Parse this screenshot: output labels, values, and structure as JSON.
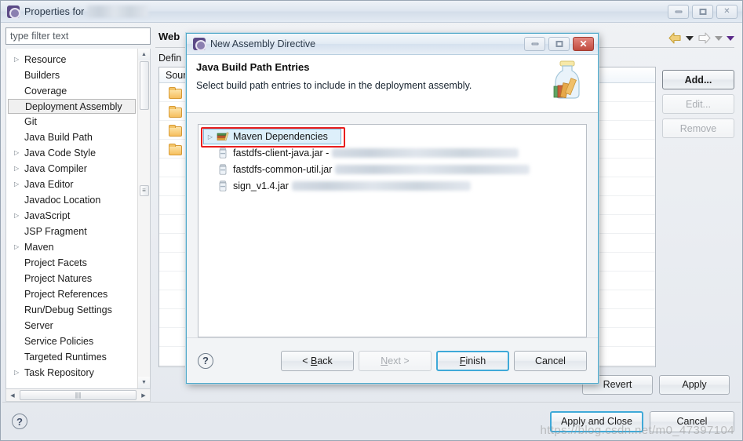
{
  "window": {
    "title": "Properties for",
    "title_redacted": true,
    "icon": "eclipse-properties-icon",
    "controls": {
      "minimize": "minimize-icon",
      "maximize": "maximize-icon",
      "close": "close-icon"
    }
  },
  "sidebar": {
    "filter": {
      "placeholder": "type filter text",
      "value": ""
    },
    "items": [
      {
        "label": "Resource",
        "expandable": true,
        "selected": false
      },
      {
        "label": "Builders",
        "expandable": false,
        "selected": false
      },
      {
        "label": "Coverage",
        "expandable": false,
        "selected": false
      },
      {
        "label": "Deployment Assembly",
        "expandable": false,
        "selected": true
      },
      {
        "label": "Git",
        "expandable": false,
        "selected": false
      },
      {
        "label": "Java Build Path",
        "expandable": false,
        "selected": false
      },
      {
        "label": "Java Code Style",
        "expandable": true,
        "selected": false
      },
      {
        "label": "Java Compiler",
        "expandable": true,
        "selected": false
      },
      {
        "label": "Java Editor",
        "expandable": true,
        "selected": false
      },
      {
        "label": "Javadoc Location",
        "expandable": false,
        "selected": false
      },
      {
        "label": "JavaScript",
        "expandable": true,
        "selected": false
      },
      {
        "label": "JSP Fragment",
        "expandable": false,
        "selected": false
      },
      {
        "label": "Maven",
        "expandable": true,
        "selected": false
      },
      {
        "label": "Project Facets",
        "expandable": false,
        "selected": false
      },
      {
        "label": "Project Natures",
        "expandable": false,
        "selected": false
      },
      {
        "label": "Project References",
        "expandable": false,
        "selected": false
      },
      {
        "label": "Run/Debug Settings",
        "expandable": false,
        "selected": false
      },
      {
        "label": "Server",
        "expandable": false,
        "selected": false
      },
      {
        "label": "Service Policies",
        "expandable": false,
        "selected": false
      },
      {
        "label": "Targeted Runtimes",
        "expandable": false,
        "selected": false
      },
      {
        "label": "Task Repository",
        "expandable": true,
        "selected": false
      }
    ]
  },
  "content": {
    "page_title": "Web",
    "defined_label": "Defin",
    "table": {
      "header": "Sour",
      "rows": [
        {
          "icon": "folder-icon"
        },
        {
          "icon": "folder-icon"
        },
        {
          "icon": "folder-icon"
        },
        {
          "icon": "folder-icon"
        },
        {
          "icon": ""
        },
        {
          "icon": ""
        },
        {
          "icon": ""
        },
        {
          "icon": ""
        },
        {
          "icon": ""
        },
        {
          "icon": ""
        },
        {
          "icon": ""
        },
        {
          "icon": ""
        },
        {
          "icon": ""
        },
        {
          "icon": ""
        },
        {
          "icon": ""
        }
      ]
    },
    "side_buttons": [
      {
        "label": "Add...",
        "enabled": true
      },
      {
        "label": "Edit...",
        "enabled": false
      },
      {
        "label": "Remove",
        "enabled": false
      }
    ],
    "bottom_buttons": [
      {
        "label": "Revert",
        "enabled": true
      },
      {
        "label": "Apply",
        "enabled": true
      }
    ],
    "nav": {
      "back_icon": "back-arrow-icon",
      "back_dropdown_icon": "chevron-down-icon",
      "forward_icon": "forward-arrow-icon",
      "forward_dropdown_icon": "chevron-down-icon",
      "menu_icon": "chevron-down-icon"
    }
  },
  "footer": {
    "help_icon": "help-icon",
    "buttons": [
      {
        "label": "Apply and Close",
        "default": true
      },
      {
        "label": "Cancel",
        "default": false
      }
    ]
  },
  "dialog": {
    "title": "New Assembly Directive",
    "icon": "eclipse-wizard-icon",
    "controls": {
      "minimize": "minimize-icon",
      "maximize": "maximize-icon",
      "close": "close-icon"
    },
    "heading": "Java Build Path Entries",
    "description": "Select build path entries to include in the deployment assembly.",
    "banner_icon": "jar-bottle-icon",
    "entries": [
      {
        "label": "Maven Dependencies",
        "icon": "maven-library-icon",
        "selected": true,
        "highlighted": true,
        "expandable": true,
        "path_redacted": false,
        "path_redact_width": 0
      },
      {
        "label": "fastdfs-client-java.jar -",
        "icon": "jar-icon",
        "selected": false,
        "highlighted": false,
        "expandable": false,
        "path_redacted": true,
        "path_redact_width": 238
      },
      {
        "label": "fastdfs-common-util.jar",
        "icon": "jar-icon",
        "selected": false,
        "highlighted": false,
        "expandable": false,
        "path_redacted": true,
        "path_redact_width": 248
      },
      {
        "label": "sign_v1.4.jar",
        "icon": "jar-icon",
        "selected": false,
        "highlighted": false,
        "expandable": false,
        "path_redacted": true,
        "path_redact_width": 228
      }
    ],
    "help_icon": "help-icon",
    "buttons": [
      {
        "label": "< Back",
        "mnemonic": "B",
        "enabled": true,
        "default": false
      },
      {
        "label": "Next >",
        "mnemonic": "N",
        "enabled": false,
        "default": false
      },
      {
        "label": "Finish",
        "mnemonic": "F",
        "enabled": true,
        "default": true
      },
      {
        "label": "Cancel",
        "mnemonic": "",
        "enabled": true,
        "default": false
      }
    ]
  },
  "watermark": "https://blog.csdn.net/m0_47397104",
  "colors": {
    "dialog_border": "#4fa8c9",
    "highlight_red": "#e81e1e",
    "selection_blue": "#ddeffa",
    "default_button_outline": "#3fa9d8",
    "folder_icon": "#f6bf5e",
    "back_arrow": "#e8c257"
  }
}
